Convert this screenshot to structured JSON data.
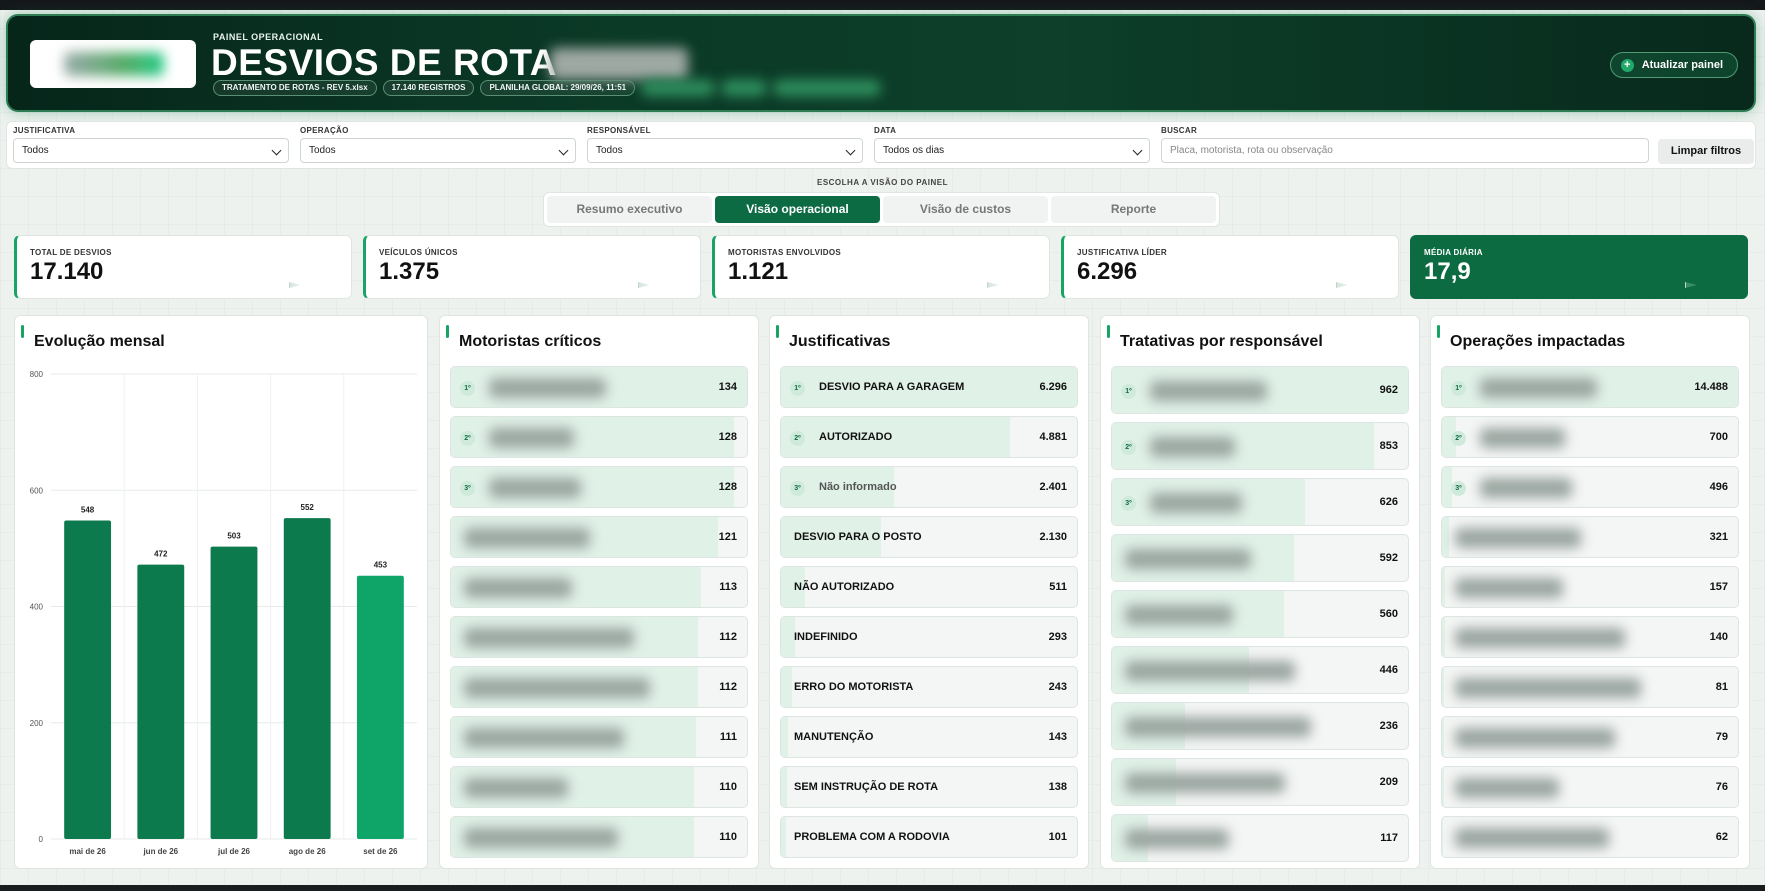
{
  "header": {
    "eyebrow": "PAINEL OPERACIONAL",
    "title": "DESVIOS DE ROTA",
    "chips": [
      "TRATAMENTO DE ROTAS - REV 5.xlsx",
      "17.140 REGISTROS",
      "PLANILHA GLOBAL: 29/09/26, 11:51"
    ],
    "refresh_label": "Atualizar painel"
  },
  "filters": {
    "justificativa": {
      "label": "JUSTIFICATIVA",
      "value": "Todos"
    },
    "operacao": {
      "label": "OPERAÇÃO",
      "value": "Todos"
    },
    "responsavel": {
      "label": "RESPONSÁVEL",
      "value": "Todos"
    },
    "data": {
      "label": "DATA",
      "value": "Todos os dias"
    },
    "buscar": {
      "label": "BUSCAR",
      "placeholder": "Placa, motorista, rota ou observação"
    },
    "clear_label": "Limpar filtros"
  },
  "view": {
    "choose_label": "ESCOLHA A VISÃO DO PAINEL",
    "tabs": [
      "Resumo executivo",
      "Visão operacional",
      "Visão de custos",
      "Reporte"
    ],
    "active_tab": "Visão operacional"
  },
  "kpis": [
    {
      "label": "TOTAL DE DESVIOS",
      "value": "17.140"
    },
    {
      "label": "VEÍCULOS ÚNICOS",
      "value": "1.375"
    },
    {
      "label": "MOTORISTAS ENVOLVIDOS",
      "value": "1.121"
    },
    {
      "label": "JUSTIFICATIVA LÍDER",
      "value": "6.296"
    },
    {
      "label": "MÉDIA DIÁRIA",
      "value": "17,9"
    }
  ],
  "panels": {
    "evolucao": {
      "title": "Evolução mensal"
    },
    "motoristas": {
      "title": "Motoristas críticos",
      "values": [
        "134",
        "128",
        "128",
        "121",
        "113",
        "112",
        "112",
        "111",
        "110",
        "110"
      ]
    },
    "justificativas": {
      "title": "Justificativas",
      "items": [
        {
          "label": "DESVIO PARA A GARAGEM",
          "value": "6.296"
        },
        {
          "label": "AUTORIZADO",
          "value": "4.881"
        },
        {
          "label": "Não informado",
          "value": "2.401"
        },
        {
          "label": "DESVIO PARA O POSTO",
          "value": "2.130"
        },
        {
          "label": "NÃO AUTORIZADO",
          "value": "511"
        },
        {
          "label": "INDEFINIDO",
          "value": "293"
        },
        {
          "label": "ERRO DO MOTORISTA",
          "value": "243"
        },
        {
          "label": "MANUTENÇÃO",
          "value": "143"
        },
        {
          "label": "SEM INSTRUÇÃO DE ROTA",
          "value": "138"
        },
        {
          "label": "PROBLEMA COM A RODOVIA",
          "value": "101"
        }
      ]
    },
    "tratativas": {
      "title": "Tratativas por responsável",
      "values": [
        "962",
        "853",
        "626",
        "592",
        "560",
        "446",
        "236",
        "209",
        "117"
      ]
    },
    "operacoes": {
      "title": "Operações impactadas",
      "values": [
        "14.488",
        "700",
        "496",
        "321",
        "157",
        "140",
        "81",
        "79",
        "76",
        "62"
      ]
    }
  },
  "rank_badges": [
    "1º",
    "2º",
    "3º"
  ],
  "chart_data": {
    "type": "bar",
    "categories": [
      "mai de 26",
      "jun de 26",
      "jul de 26",
      "ago de 26",
      "set de 26"
    ],
    "values": [
      548,
      472,
      503,
      552,
      453
    ],
    "ylim": [
      0,
      800
    ],
    "yticks": [
      0,
      200,
      400,
      600,
      800
    ],
    "title": "Evolução mensal",
    "grid": true,
    "colors": {
      "bar": "#0c7a4c",
      "bar_last": "#0fa569"
    }
  },
  "colors": {
    "accent": "#18a465",
    "dark_green": "#0c6b41",
    "fill": "#e0f1e8"
  }
}
